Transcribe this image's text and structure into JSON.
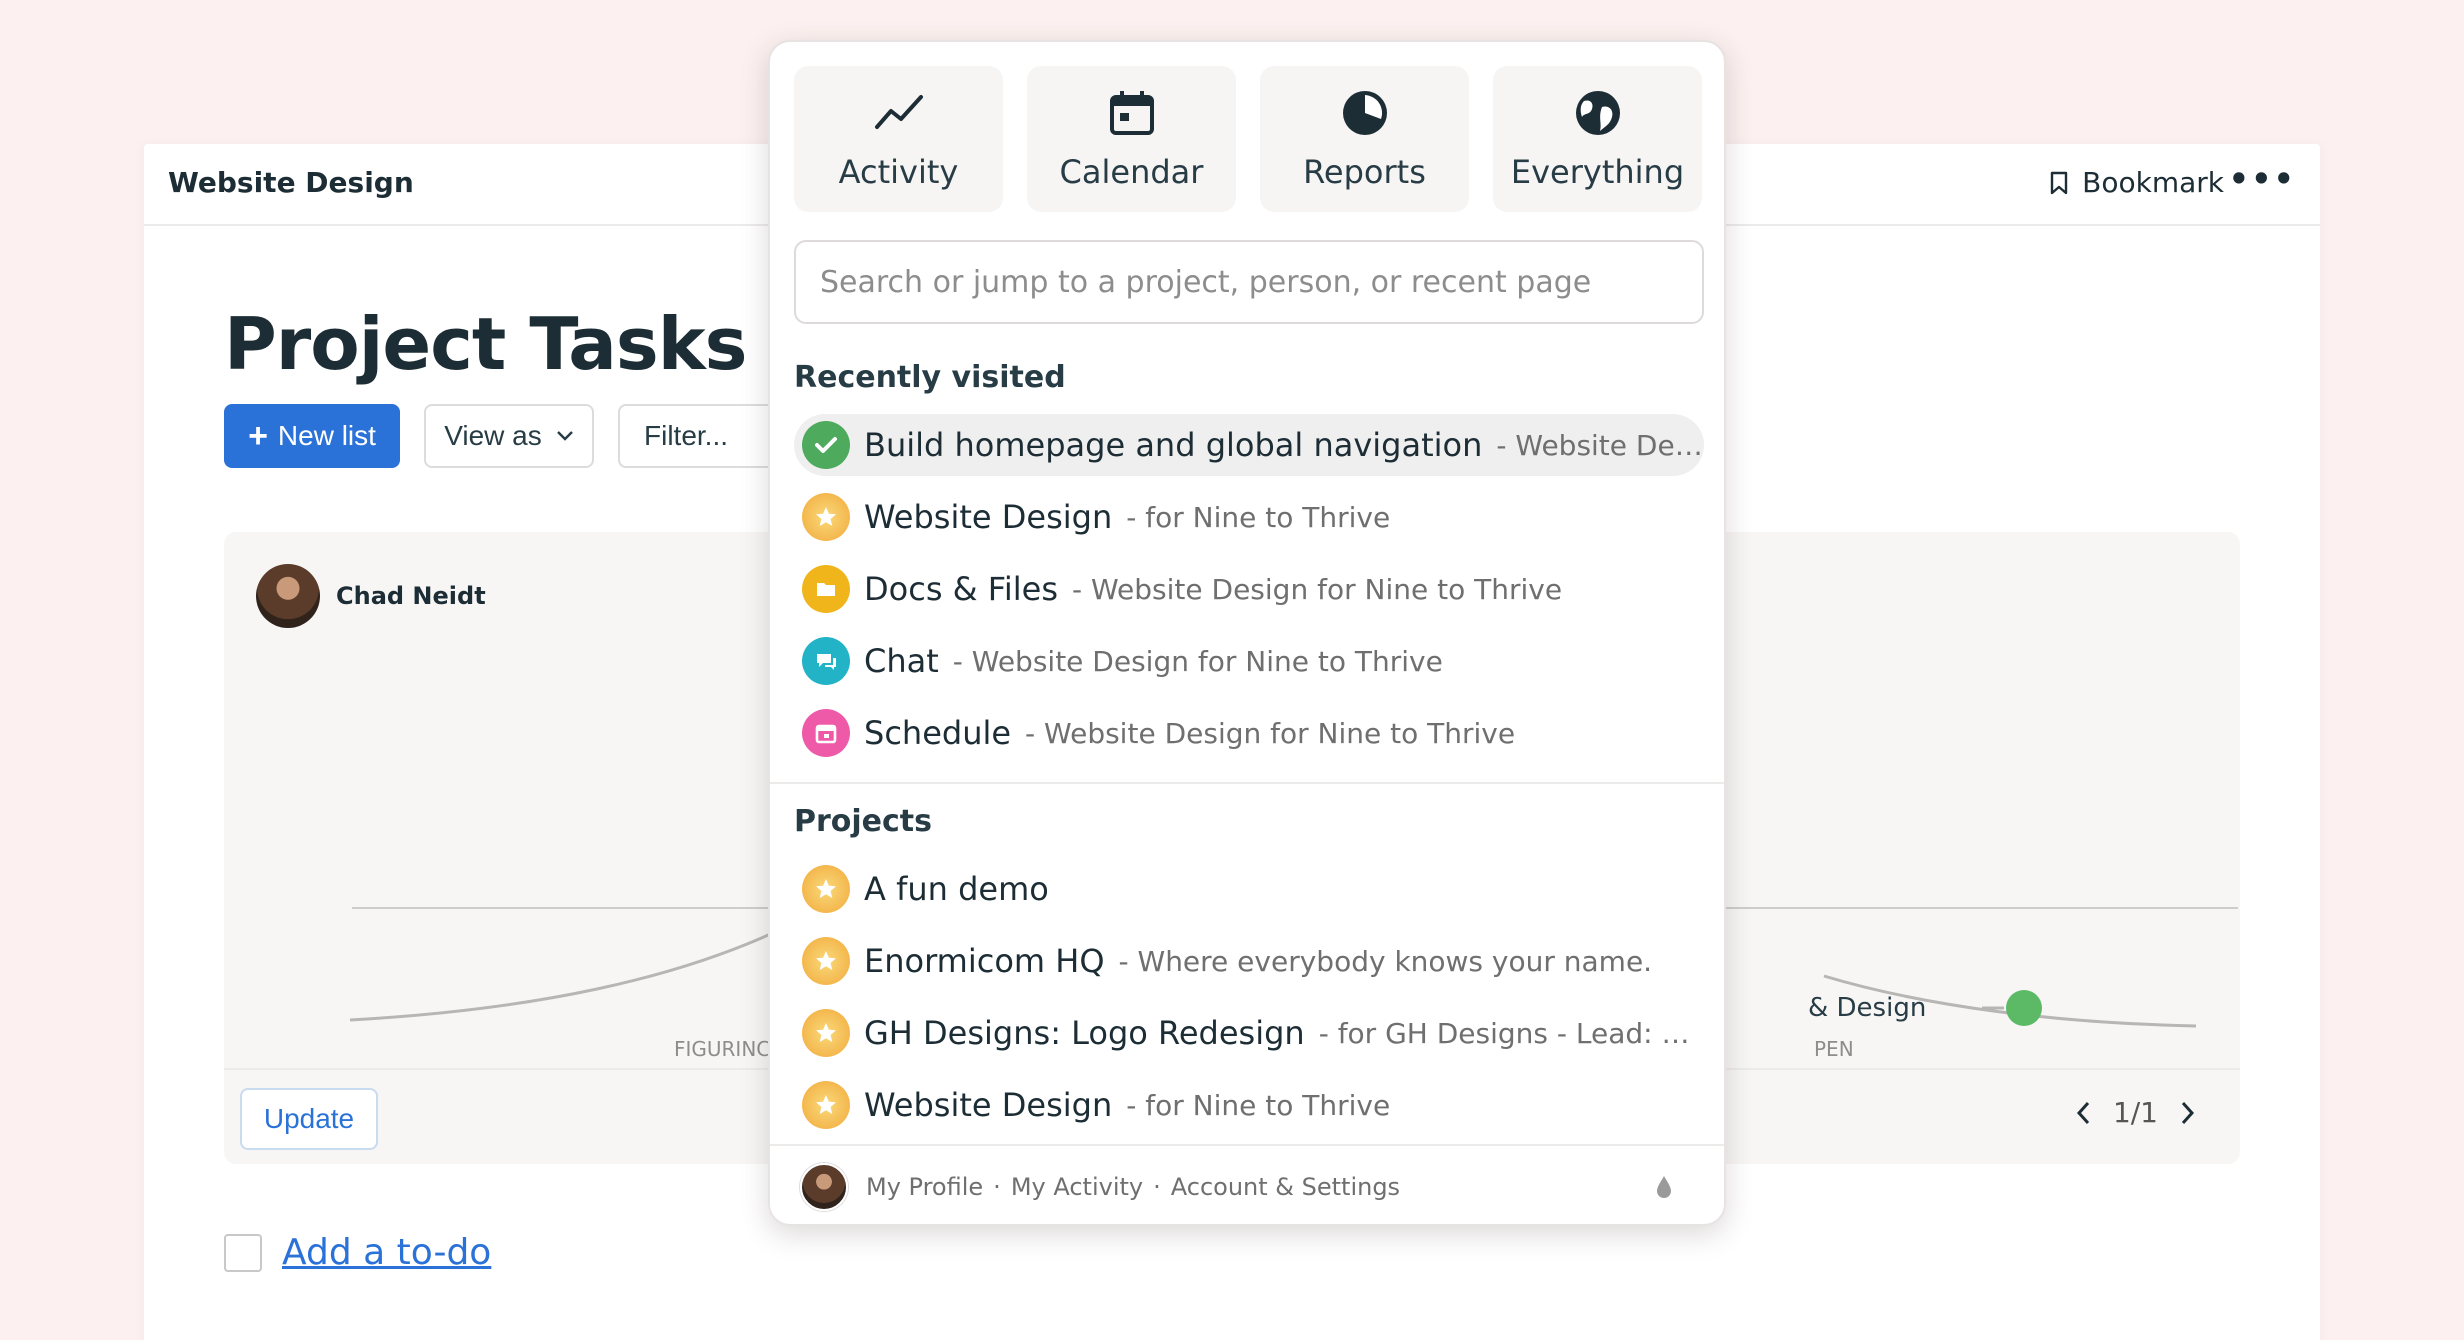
{
  "app": {
    "title": "Website Design",
    "bookmark_label": "Bookmark",
    "more_label": "•••"
  },
  "page": {
    "title": "Project Tasks",
    "new_list_label": "New list",
    "view_as_label": "View as",
    "filter_label": "Filter..."
  },
  "hill_chart": {
    "user_name": "Chad Neidt",
    "left_axis_label": "FIGURINC",
    "right_axis_label": "PEN",
    "point_label": "& Design",
    "point_color": "#5cba66",
    "update_label": "Update",
    "pager": "1/1"
  },
  "todo": {
    "add_label": "Add a to-do"
  },
  "jump_menu": {
    "tiles": [
      {
        "label": "Activity",
        "icon": "activity-icon"
      },
      {
        "label": "Calendar",
        "icon": "calendar-icon"
      },
      {
        "label": "Reports",
        "icon": "pie-chart-icon"
      },
      {
        "label": "Everything",
        "icon": "globe-icon"
      }
    ],
    "search_placeholder": "Search or jump to a project, person, or recent page",
    "recent_title": "Recently visited",
    "recent": [
      {
        "name": "Build homepage and global navigation",
        "sub": "- Website Design...",
        "icon": "check-icon",
        "color": "#4eaa5d"
      },
      {
        "name": "Website Design",
        "sub": "- for Nine to Thrive",
        "icon": "star-icon",
        "color": "#f4b544"
      },
      {
        "name": "Docs & Files",
        "sub": "- Website Design for Nine to Thrive",
        "icon": "folder-icon",
        "color": "#f0b51a"
      },
      {
        "name": "Chat",
        "sub": "- Website Design for Nine to Thrive",
        "icon": "chat-icon",
        "color": "#22b3c7"
      },
      {
        "name": "Schedule",
        "sub": "- Website Design for Nine to Thrive",
        "icon": "schedule-icon",
        "color": "#ee5aa8"
      }
    ],
    "projects_title": "Projects",
    "projects": [
      {
        "name": "A fun demo",
        "sub": "",
        "icon": "star-icon"
      },
      {
        "name": "Enormicom HQ",
        "sub": "- Where everybody knows your name.",
        "icon": "star-icon"
      },
      {
        "name": "GH Designs: Logo Redesign",
        "sub": "- for GH Designs - Lead: Sofí...",
        "icon": "star-icon"
      },
      {
        "name": "Website Design",
        "sub": "- for Nine to Thrive",
        "icon": "star-icon"
      }
    ],
    "footer": {
      "profile": "My Profile",
      "activity": "My Activity",
      "settings": "Account & Settings",
      "separator": "·"
    }
  }
}
